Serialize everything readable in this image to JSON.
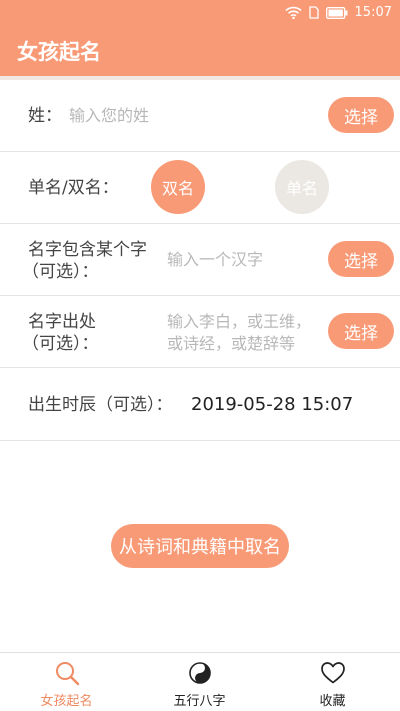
{
  "status": {
    "time": "15:07"
  },
  "app": {
    "title": "女孩起名"
  },
  "form": {
    "surname": {
      "label": "姓：",
      "placeholder": "输入您的姓",
      "button": "选择"
    },
    "name_type": {
      "label": "单名/双名：",
      "double": "双名",
      "single": "单名",
      "selected": "双名"
    },
    "contains": {
      "label_line1": "名字包含某个字",
      "label_line2": "（可选）：",
      "placeholder": "输入一个汉字",
      "button": "选择"
    },
    "source": {
      "label_line1": "名字出处",
      "label_line2": "（可选）：",
      "placeholder_line1": "输入李白，或王维，",
      "placeholder_line2": "或诗经，或楚辞等",
      "button": "选择"
    },
    "birth": {
      "label": "出生时辰（可选）：",
      "value": "2019-05-28 15:07"
    }
  },
  "main_button": "从诗词和典籍中取名",
  "tabs": [
    {
      "label": "女孩起名",
      "icon": "search-icon",
      "active": true
    },
    {
      "label": "五行八字",
      "icon": "yin-yang-icon",
      "active": false
    },
    {
      "label": "收藏",
      "icon": "heart-icon",
      "active": false
    }
  ],
  "colors": {
    "accent": "#f99a77",
    "inactive_circle": "#ebe8e3"
  }
}
